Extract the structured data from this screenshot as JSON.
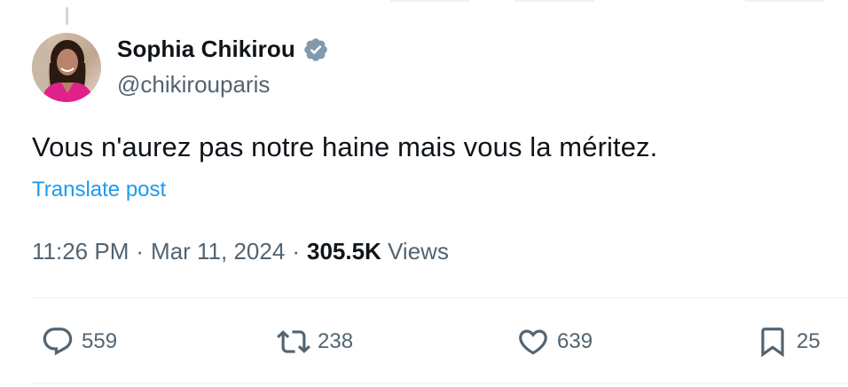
{
  "author": {
    "display_name": "Sophia Chikirou",
    "handle": "@chikirouparis",
    "verified_icon": "verified-badge-icon",
    "verified_color": "#829aab"
  },
  "post": {
    "text": "Vous n'aurez pas notre haine mais vous la méritez.",
    "translate_label": "Translate post"
  },
  "meta": {
    "time": "11:26 PM",
    "separator": "·",
    "date": "Mar 11, 2024",
    "views_count": "305.5K",
    "views_label": "Views"
  },
  "actions": {
    "reply": {
      "icon": "reply-icon",
      "count": "559"
    },
    "repost": {
      "icon": "repost-icon",
      "count": "238"
    },
    "like": {
      "icon": "heart-icon",
      "count": "639"
    },
    "bookmark": {
      "icon": "bookmark-icon",
      "count": "25"
    }
  },
  "colors": {
    "text_primary": "#0f1419",
    "text_secondary": "#536471",
    "link": "#1d9bf0",
    "divider": "#eff3f4"
  }
}
